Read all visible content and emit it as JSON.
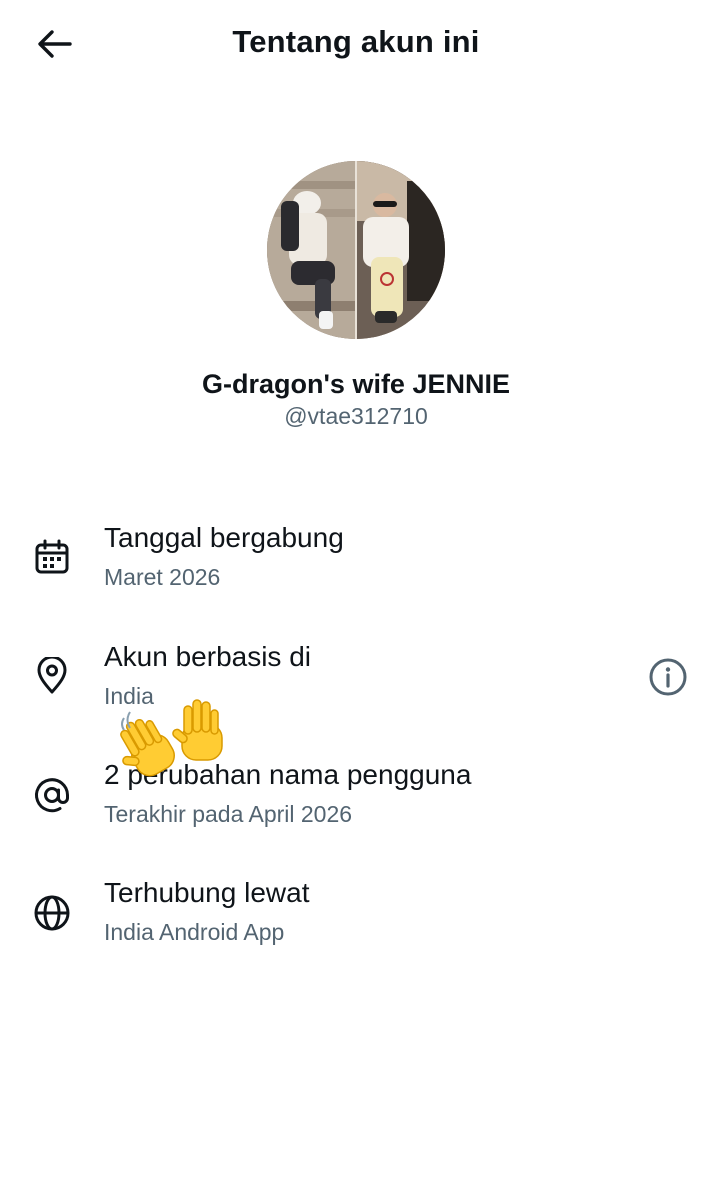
{
  "header": {
    "title": "Tentang akun ini",
    "back_icon": "arrow-left-icon"
  },
  "profile": {
    "display_name": "G-dragon's wife JENNIE",
    "handle": "@vtae312710"
  },
  "details": [
    {
      "icon": "calendar-icon",
      "label": "Tanggal bergabung",
      "value": "Maret 2026"
    },
    {
      "icon": "location-pin-icon",
      "label": "Akun berbasis di",
      "value": "India",
      "action_icon": "info-icon"
    },
    {
      "icon": "at-sign-icon",
      "label": "2 perubahan nama pengguna",
      "value": "Terakhir pada April 2026"
    },
    {
      "icon": "globe-icon",
      "label": "Terhubung lewat",
      "value": "India Android App"
    }
  ],
  "overlay": {
    "sticker": "waving-hands-emoji"
  },
  "colors": {
    "text_primary": "#0f1419",
    "text_secondary": "#536471",
    "background": "#ffffff"
  }
}
